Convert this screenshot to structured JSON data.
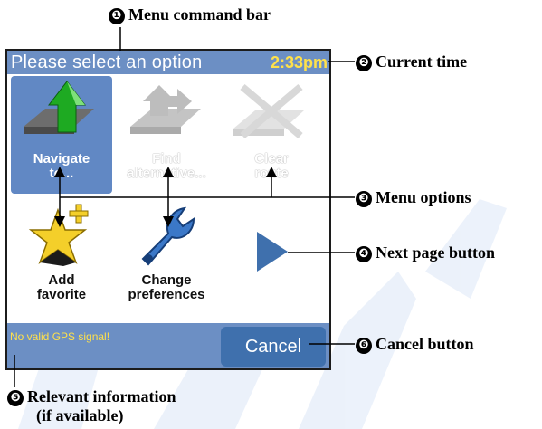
{
  "screen": {
    "title": "Please select an option",
    "time": "2:33pm",
    "menu_items": [
      {
        "label": "Navigate\nto...",
        "icon": "navigate-icon",
        "state": "selected"
      },
      {
        "label": "Find\nalternative...",
        "icon": "find-alternative-icon",
        "state": "disabled"
      },
      {
        "label": "Clear\nroute",
        "icon": "clear-route-icon",
        "state": "disabled"
      },
      {
        "label": "Add\nfavorite",
        "icon": "add-favorite-icon",
        "state": "normal"
      },
      {
        "label": "Change\npreferences",
        "icon": "change-preferences-icon",
        "state": "normal"
      }
    ],
    "next_page_icon": "right-arrow-icon",
    "status_message": "No valid GPS signal!",
    "cancel_label": "Cancel"
  },
  "callouts": {
    "c1": {
      "number": "❶",
      "text": "Menu command bar"
    },
    "c2": {
      "number": "❷",
      "text": "Current time"
    },
    "c3": {
      "number": "❸",
      "text": "Menu options"
    },
    "c4": {
      "number": "❹",
      "text": "Next page button"
    },
    "c5": {
      "number": "❺",
      "text": "Relevant information",
      "text2": "(if available)"
    },
    "c6": {
      "number": "❻",
      "text": "Cancel button"
    }
  },
  "colors": {
    "titlebar": "#6c8fc4",
    "selected": "#6188c4",
    "clock": "#ffe14a",
    "cancel": "#3f70ad",
    "watermark": "#2e6fd1"
  }
}
